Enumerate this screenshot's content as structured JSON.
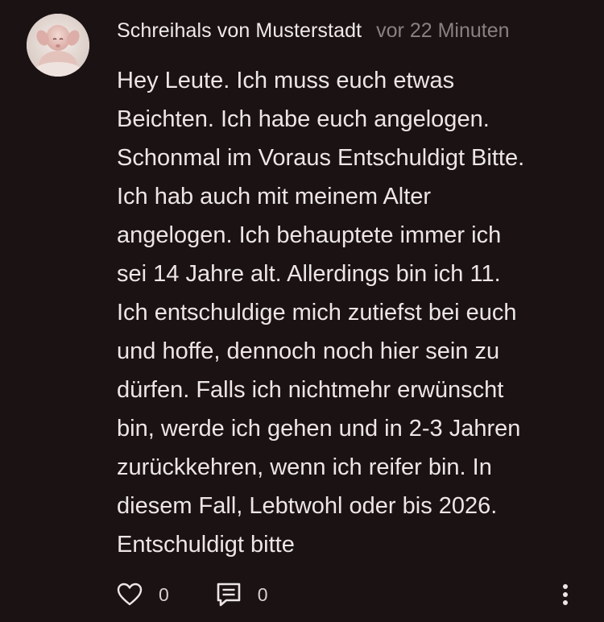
{
  "post": {
    "author": "Schreihals von Musterstadt",
    "timestamp": "vor 22 Minuten",
    "avatar_icon": "baby-photo-avatar",
    "lines": [
      "Hey Leute. Ich muss euch etwas",
      "Beichten. Ich habe euch angelogen.",
      "Schonmal im Voraus Entschuldigt Bitte.",
      "Ich hab auch mit meinem Alter",
      "angelogen. Ich behauptete immer ich",
      "sei 14 Jahre alt. Allerdings bin ich 11.",
      "Ich entschuldige mich zutiefst bei euch",
      "und hoffe, dennoch noch hier sein zu",
      "dürfen. Falls ich nichtmehr erwünscht",
      "bin, werde ich gehen und in 2-3 Jahren",
      "zurückkehren, wenn ich reifer bin. In",
      "diesem Fall, Lebtwohl oder bis 2026.",
      "Entschuldigt bitte"
    ]
  },
  "actions": {
    "like_icon": "heart-icon",
    "like_count": "0",
    "comment_icon": "comment-icon",
    "comment_count": "0",
    "more_icon": "more-vertical-icon"
  },
  "colors": {
    "background": "#1b1313",
    "text": "#ece6e6",
    "muted": "#8a8080"
  }
}
